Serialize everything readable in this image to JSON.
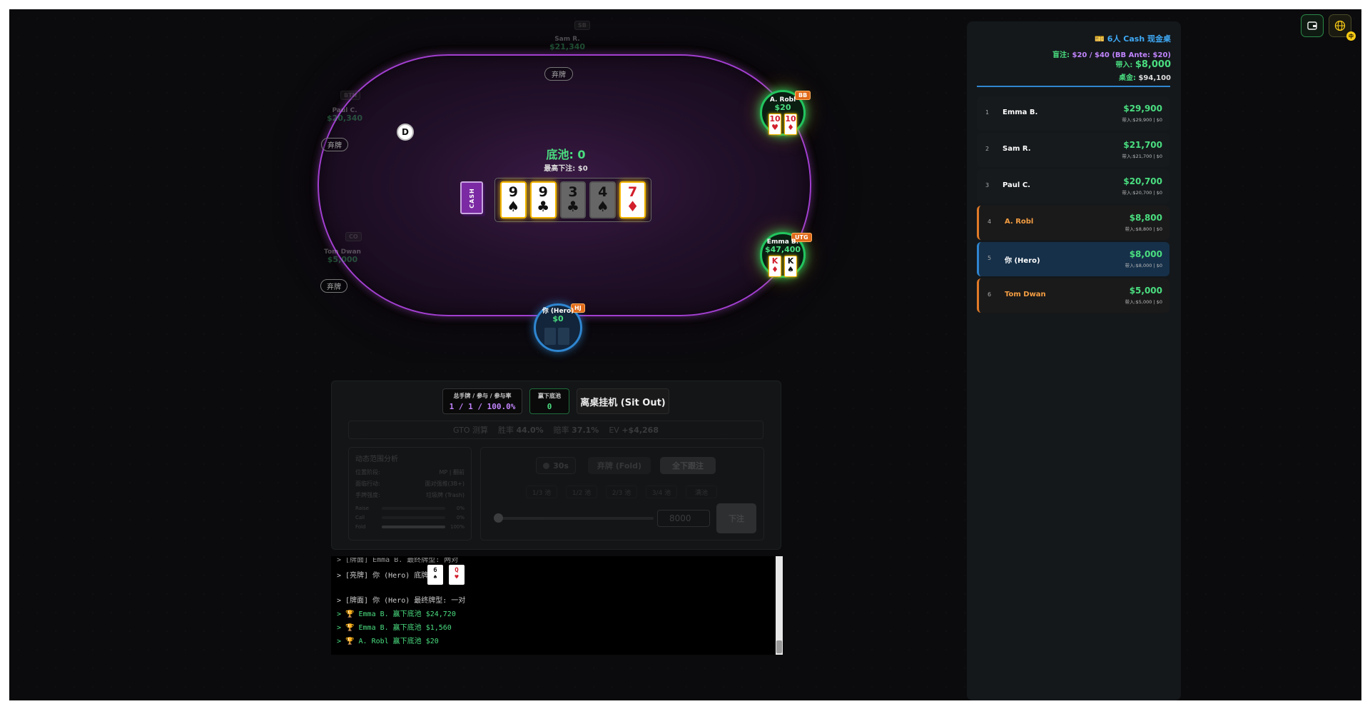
{
  "table": {
    "pot_label": "底池: 0",
    "max_bet_label": "最高下注: $0",
    "deck_label": "CASH",
    "dealer_button": "D",
    "fold_label": "弃牌",
    "board_cards": [
      {
        "rank": "9",
        "suit": "♠",
        "color": "black",
        "faded": false
      },
      {
        "rank": "9",
        "suit": "♣",
        "color": "black",
        "faded": false
      },
      {
        "rank": "3",
        "suit": "♣",
        "color": "black",
        "faded": true
      },
      {
        "rank": "4",
        "suit": "♠",
        "color": "black",
        "faded": true
      },
      {
        "rank": "7",
        "suit": "♦",
        "color": "red",
        "faded": false
      }
    ],
    "seats": {
      "sb": {
        "position": "SB",
        "name": "Sam R.",
        "stack": "$21,340"
      },
      "btn": {
        "position": "BTN",
        "name": "Paul C.",
        "stack": "$20,340"
      },
      "co": {
        "position": "CO",
        "name": "Tom Dwan",
        "stack": "$5,000"
      },
      "bb": {
        "position": "BB",
        "name": "A. Robl",
        "stack": "$20",
        "cards": [
          {
            "rank": "10",
            "suit": "♥"
          },
          {
            "rank": "10",
            "suit": "♦"
          }
        ]
      },
      "utg": {
        "position": "UTG",
        "name": "Emma B.",
        "stack": "$47,400",
        "cards": [
          {
            "rank": "K",
            "suit": "♦"
          },
          {
            "rank": "K",
            "suit": "♠"
          }
        ]
      },
      "hj": {
        "position": "HJ",
        "name": "你 (Hero)",
        "stack": "$0"
      }
    }
  },
  "panel": {
    "stats_label": "总手牌 / 参与 / 参与率",
    "stats_value": "1 / 1 / 100.0%",
    "won_label": "赢下底池",
    "won_value": "0",
    "sitout_label": "离桌挂机 (Sit Out)",
    "gto_label": "GTO 测算",
    "win_rate_label": "胜率",
    "win_rate": "44.0%",
    "odds_label": "赔率",
    "odds": "37.1%",
    "ev_label": "EV",
    "ev": "+$4,268",
    "range_title": "动态范围分析",
    "range_rows": [
      {
        "k": "位置阶段:",
        "v": "MP | 翻前"
      },
      {
        "k": "面临行动:",
        "v": "面对强推(3B+)"
      },
      {
        "k": "手牌强度:",
        "v": "垃圾牌 (Trash)"
      }
    ],
    "freq": [
      {
        "k": "Raise",
        "v": "0%",
        "pct": 0
      },
      {
        "k": "Call",
        "v": "0%",
        "pct": 0
      },
      {
        "k": "Fold",
        "v": "100%",
        "pct": 100
      }
    ],
    "timer": "30s",
    "fold_button": "弃牌 (Fold)",
    "allin_button": "全下跟注",
    "presets": [
      "1/3 池",
      "1/2 池",
      "2/3 池",
      "3/4 池",
      "满池"
    ],
    "bet_amount": "8000",
    "bet_button": "下注"
  },
  "log": {
    "lines": [
      "> [牌面] Emma B. 最终牌型: 两对",
      "> [亮牌] 你 (Hero) 底牌:",
      "> [牌面] 你 (Hero) 最终牌型: 一对",
      "> 🏆 Emma B. 赢下底池 $24,720",
      "> 🏆 Emma B. 赢下底池 $1,560",
      "> 🏆 A. Robl 赢下底池 $20"
    ],
    "hero_cards": [
      {
        "rank": "6",
        "suit": "♠"
      },
      {
        "rank": "Q",
        "suit": "♥"
      }
    ]
  },
  "sidebar": {
    "title": "🎫 6人 Cash 现金桌",
    "blinds_label": "盲注:",
    "blinds_value": "$20 / $40 (BB Ante: $20)",
    "buyin_label": "带入:",
    "buyin_value": "$8,000",
    "total_label": "桌金:",
    "total_value": "$94,100",
    "leaderboard": [
      {
        "rank": "1",
        "name": "Emma B.",
        "stack": "$29,900",
        "sub": "带入:$29,900 | $0",
        "style": "normal"
      },
      {
        "rank": "2",
        "name": "Sam R.",
        "stack": "$21,700",
        "sub": "带入:$21,700 | $0",
        "style": "normal"
      },
      {
        "rank": "3",
        "name": "Paul C.",
        "stack": "$20,700",
        "sub": "带入:$20,700 | $0",
        "style": "normal"
      },
      {
        "rank": "4",
        "name": "A. Robl",
        "stack": "$8,800",
        "sub": "带入:$8,800 | $0",
        "style": "orange"
      },
      {
        "rank": "5",
        "name": "你 (Hero)",
        "stack": "$8,000",
        "sub": "带入:$8,000 | $0",
        "style": "hero"
      },
      {
        "rank": "6",
        "name": "Tom Dwan",
        "stack": "$5,000",
        "sub": "带入:$5,000 | $0",
        "style": "orange"
      }
    ]
  },
  "topbar": {
    "lang_badge": "中"
  },
  "colors": {
    "accent_green": "#4ade80",
    "felt_border": "#a23fd0",
    "badge_orange": "#e06a1a",
    "hero_blue": "#2f86d0"
  }
}
